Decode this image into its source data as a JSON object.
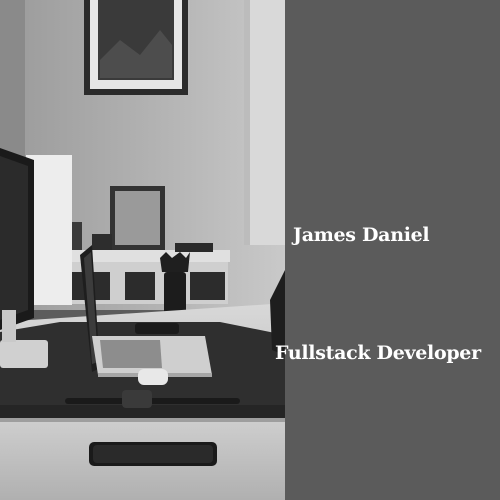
{
  "profile": {
    "name": "James Daniel",
    "title": "Fullstack Developer"
  },
  "colors": {
    "panel": "#5b5b5b",
    "text": "#ffffff"
  },
  "image": {
    "subject": "grayscale-office-desk-photo"
  }
}
